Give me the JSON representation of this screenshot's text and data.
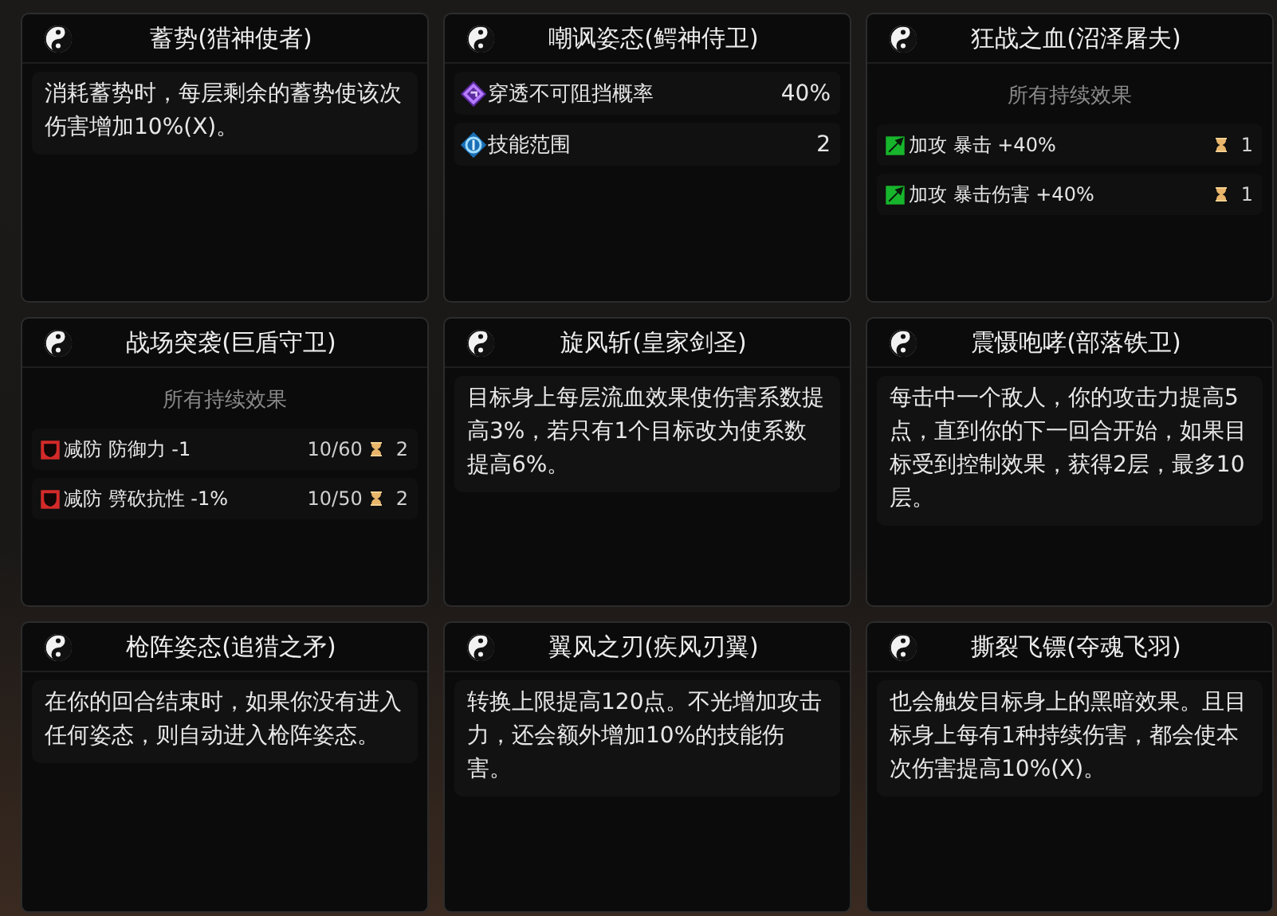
{
  "cards": [
    {
      "title": "蓄势(猎神使者)",
      "kind": "text",
      "text": "消耗蓄势时，每层剩余的蓄势使该次伤害增加10%(X)。"
    },
    {
      "title": "嘲讽姿态(鳄神侍卫)",
      "kind": "stats",
      "stats": [
        {
          "kind": "pierce",
          "label": "穿透不可阻挡概率",
          "value": "40%"
        },
        {
          "kind": "range",
          "label": "技能范围",
          "value": "2"
        }
      ]
    },
    {
      "title": "狂战之血(沼泽屠夫)",
      "kind": "effects",
      "heading": "所有持续效果",
      "effects": [
        {
          "kind": "buff",
          "label": "加攻 暴击 +40%",
          "duration": "1"
        },
        {
          "kind": "buff",
          "label": "加攻 暴击伤害 +40%",
          "duration": "1"
        }
      ]
    },
    {
      "title": "战场突袭(巨盾守卫)",
      "kind": "effects",
      "heading": "所有持续效果",
      "effects": [
        {
          "kind": "debuff",
          "label": "减防 防御力 -1",
          "stacks": "10/60",
          "duration": "2"
        },
        {
          "kind": "debuff",
          "label": "减防 劈砍抗性 -1%",
          "stacks": "10/50",
          "duration": "2"
        }
      ]
    },
    {
      "title": "旋风斩(皇家剑圣)",
      "kind": "text",
      "text": "目标身上每层流血效果使伤害系数提高3%，若只有1个目标改为使系数提高6%。"
    },
    {
      "title": "震慑咆哮(部落铁卫)",
      "kind": "text",
      "text": "每击中一个敌人，你的攻击力提高5点，直到你的下一回合开始，如果目标受到控制效果，获得2层，最多10层。"
    },
    {
      "title": "枪阵姿态(追猎之矛)",
      "kind": "text",
      "text": "在你的回合结束时，如果你没有进入任何姿态，则自动进入枪阵姿态。"
    },
    {
      "title": "翼风之刃(疾风刃翼)",
      "kind": "text",
      "text": "转换上限提高120点。不光增加攻击力，还会额外增加10%的技能伤害。"
    },
    {
      "title": "撕裂飞镖(夺魂飞羽)",
      "kind": "text",
      "text": "也会触发目标身上的黑暗效果。且目标身上每有1种持续伤害，都会使本次伤害提高10%(X)。"
    }
  ]
}
